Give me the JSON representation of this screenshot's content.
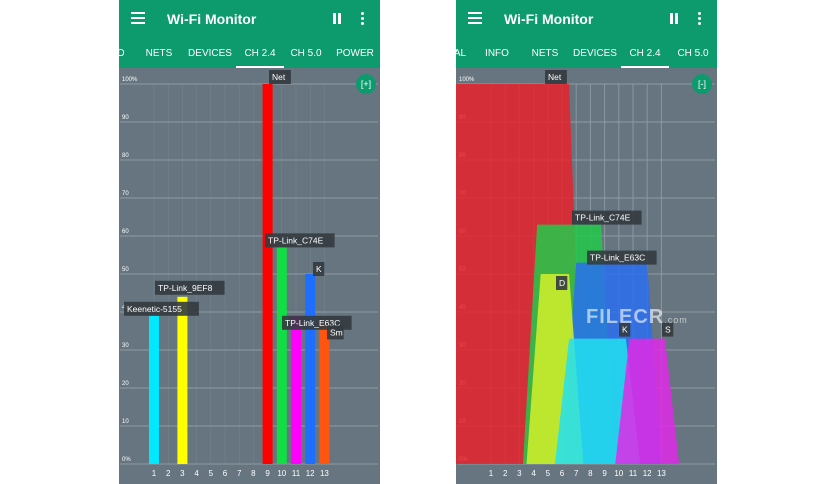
{
  "app": {
    "title": "Wi-Fi Monitor"
  },
  "colors": {
    "accent": "#0d9a6c",
    "plot_bg": "#66757f",
    "grid": "#8f9ba3"
  },
  "icons": {
    "menu": "hamburger-icon",
    "pause": "pause-icon",
    "more": "more-vert-icon"
  },
  "screens": [
    {
      "tabs": [
        "D",
        "NETS",
        "DEVICES",
        "CH 2.4",
        "CH 5.0",
        "POWER"
      ],
      "active_tab": "CH 2.4",
      "zoom_label": "[+]",
      "chart_data": {
        "type": "bar",
        "x": [
          1,
          2,
          3,
          4,
          5,
          6,
          7,
          8,
          9,
          10,
          11,
          12,
          13
        ],
        "y_ticks": [
          "100%",
          "90",
          "80",
          "70",
          "60",
          "50",
          "40",
          "30",
          "20",
          "10",
          "0%"
        ],
        "ylim": [
          0,
          100
        ],
        "series": [
          {
            "name": "Keenetic-5155",
            "channel": 1,
            "value": 39,
            "color": "#00e8ff"
          },
          {
            "name": "TP-Link_9EF8",
            "channel": 3,
            "value": 44,
            "color": "#ffff00"
          },
          {
            "name": "Net",
            "channel": 9,
            "value": 100,
            "color": "#ff0000"
          },
          {
            "name": "TP-Link_C74E",
            "channel": 10,
            "value": 57,
            "color": "#11dd44"
          },
          {
            "name": "TP-Link_E63C",
            "channel": 11,
            "value": 39,
            "color": "#ff00ff"
          },
          {
            "name": "K",
            "channel": 12,
            "value": 50,
            "color": "#1f6fff"
          },
          {
            "name": "Sm",
            "channel": 13,
            "value": 37,
            "color": "#ff5511"
          }
        ]
      }
    },
    {
      "tabs": [
        "AL",
        "INFO",
        "NETS",
        "DEVICES",
        "CH 2.4",
        "CH 5.0"
      ],
      "active_tab": "CH 2.4",
      "zoom_label": "[-]",
      "watermark": "FILECR",
      "watermark_sub": ".com",
      "chart_data": {
        "type": "area",
        "x": [
          1,
          2,
          3,
          4,
          5,
          6,
          7,
          8,
          9,
          10,
          11,
          12,
          13
        ],
        "y_ticks": [
          "100%",
          "90",
          "80",
          "70",
          "60",
          "50",
          "40",
          "30",
          "20",
          "10",
          "0%"
        ],
        "ylim": [
          0,
          100
        ],
        "series": [
          {
            "name": "Net",
            "channel": 2.5,
            "width": 10,
            "value": 100,
            "color": "#e8232b"
          },
          {
            "name": "TP-Link_C74E",
            "channel": 6.5,
            "width": 6.5,
            "value": 63,
            "color": "#22c94a"
          },
          {
            "name": "TP-Link_E63C",
            "channel": 9.5,
            "width": 7,
            "value": 53,
            "color": "#2a6ff0"
          },
          {
            "name": "D",
            "channel": 5.5,
            "width": 4,
            "value": 50,
            "color": "#d4f02a"
          },
          {
            "name": "K",
            "channel": 8.5,
            "width": 6,
            "value": 33,
            "color": "#22e0f0"
          },
          {
            "name": "S",
            "channel": 12,
            "width": 4.5,
            "value": 33,
            "color": "#e02ae8"
          }
        ]
      }
    }
  ]
}
